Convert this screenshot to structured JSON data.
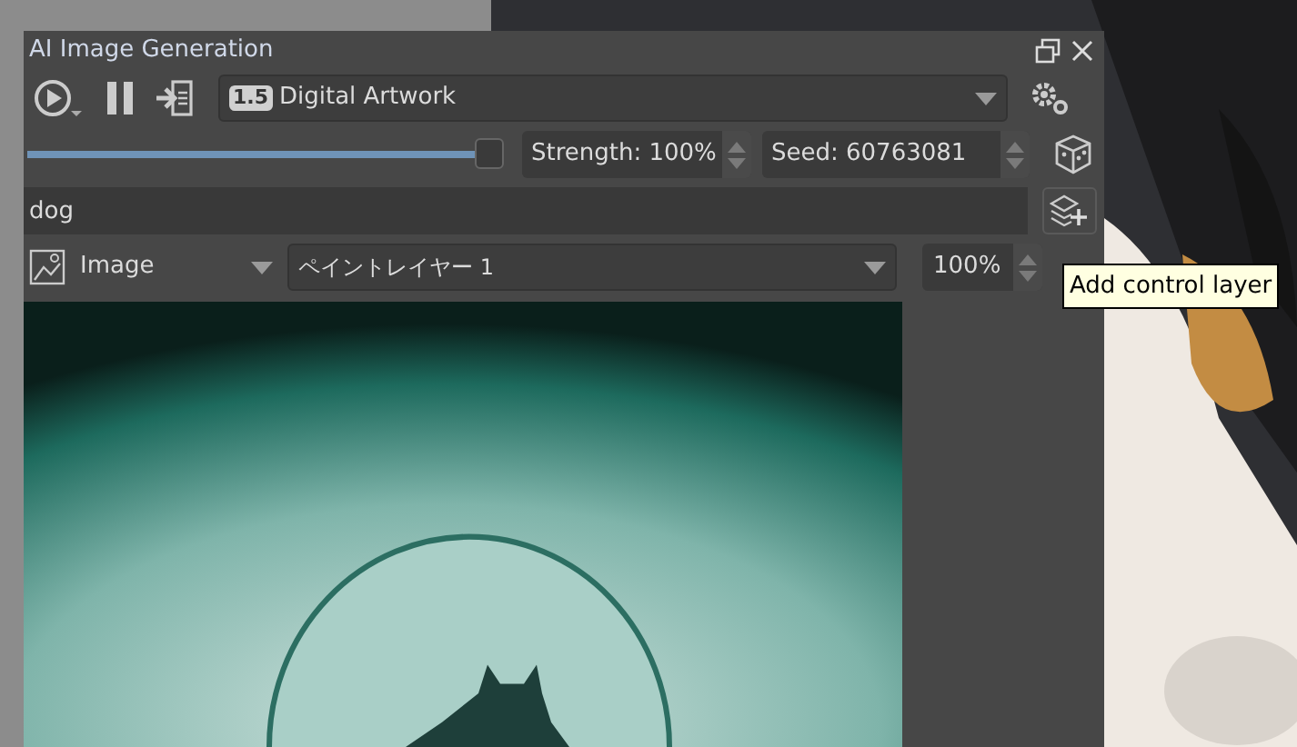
{
  "window": {
    "title": "AI Image Generation"
  },
  "model": {
    "badge": "1.5",
    "name": "Digital Artwork"
  },
  "strength_slider": {
    "level": 0.985
  },
  "strength": "Strength: 100%",
  "seed": "Seed: 60763081",
  "prompt": {
    "value": "dog"
  },
  "control_layer": {
    "kind": "Image",
    "layer": "ペイントレイヤー 1",
    "strength": "100%"
  },
  "tooltip": "Add control layer"
}
